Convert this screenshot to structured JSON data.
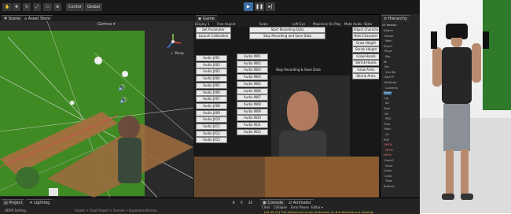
{
  "editor": {
    "scene_tab": "Scene",
    "asset_store_tab": "Asset Store",
    "center_btn": "Center",
    "global_btn": "Global",
    "gizmos_label": "Gizmos",
    "persp_label": "← Persp",
    "game_tab": "Game",
    "display": "Display 1",
    "aspect": "Free Aspect",
    "scale": "Scale",
    "eye": "Left Eye",
    "maximize": "Maximize On Play",
    "mute": "Mute Audio",
    "stats": "Stats",
    "gizmos_game": "Gizmos",
    "hierarchy_tab": "Hierarchy",
    "hierarchy_header": "03 Resistn",
    "hierarchy_items": [
      "Directi",
      "Avatar",
      "Main",
      "Player",
      "Playe",
      "Ske",
      "Mi",
      "Ste",
      "Vive Be",
      "Light Pr",
      "Reflectio",
      "Cameras",
      "Exper",
      "Lig",
      "Ap",
      "Tonn",
      "Ho",
      "PRO",
      "Thre",
      "Main",
      "Ce",
      "RUP",
      "MMTo",
      "MMTo",
      "MMTo",
      "HandS",
      "Extor",
      "Came",
      "Calib",
      "Trials",
      "Buttons"
    ],
    "project_tab": "Project",
    "lighting_tab": "Lighting",
    "hdrp_label": "HDRP Setting",
    "breadcrumb": "Assets > Final Project > Scenes > ExperimentScene",
    "console_tab": "Console",
    "animator_tab": "Animator",
    "console_clear": "Clear",
    "console_collapse": "Collapse",
    "console_errorpause": "Error Pause",
    "console_editor": "Editor ▾",
    "console_msg": "[09:45:15] The referenced script (Unknown) on this Behaviour is missing!",
    "count_a": "8",
    "count_b": "0",
    "count_c": "20"
  },
  "game_ui": {
    "set_parameter": "Set Parameter",
    "launch_calibration": "Launch Calibration",
    "start_recording": "Start Recording Data",
    "stop_recording_save": "Stop Recording and Save Data",
    "stop_recording_save_label": "Stop Recording & Save Data",
    "adjust_character": "Adjust Characte",
    "hide_character": "Hide Character",
    "grow_height": "Grow Height",
    "shrink_height": "Shrink Height",
    "grow_hands": "Grow Hands",
    "shrink_hands": "Shrink Hands",
    "grow_arms": "Grow Arms",
    "shrink_arms": "Shrink Arms",
    "audio_left": [
      "Audio JX01",
      "Audio JX02",
      "Audio JX03",
      "Audio JX04",
      "Audio JX05",
      "Audio JX06",
      "Audio JX07",
      "Audio JX08",
      "Audio JX09",
      "Audio JX10",
      "Audio JX11",
      "Audio JX12",
      "Audio JX13"
    ],
    "audio_right": [
      "Audio IN01",
      "Audio IN02",
      "Audio IN03",
      "Audio IN04",
      "Audio IN05",
      "Audio IN06",
      "Audio IN07",
      "Audio IN08",
      "Audio IN09",
      "Audio IN10",
      "Audio IN11",
      "Audio IN12"
    ]
  },
  "colors": {
    "editor_bg": "#1e1e1e",
    "green_screen": "#3f8a22",
    "table_wood": "#8a5a30",
    "selection": "#2c5d87",
    "console_text": "#e8c84a"
  }
}
